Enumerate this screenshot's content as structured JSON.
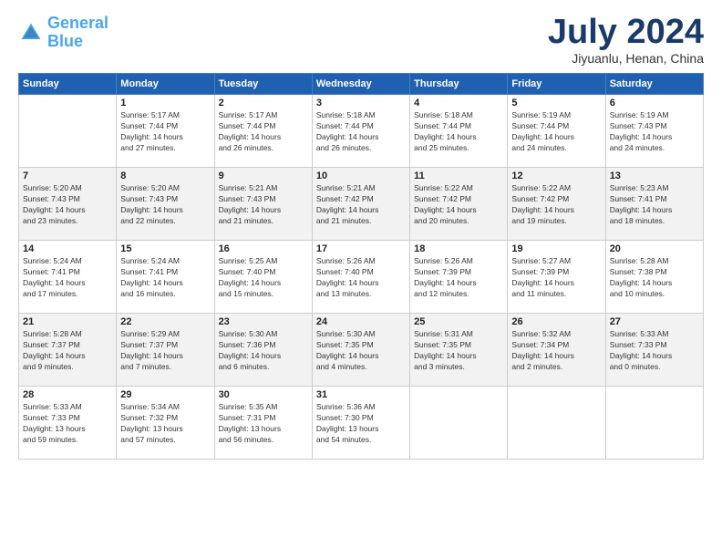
{
  "logo": {
    "line1": "General",
    "line2": "Blue"
  },
  "title": "July 2024",
  "subtitle": "Jiyuanlu, Henan, China",
  "days_of_week": [
    "Sunday",
    "Monday",
    "Tuesday",
    "Wednesday",
    "Thursday",
    "Friday",
    "Saturday"
  ],
  "weeks": [
    [
      {
        "day": "",
        "text": ""
      },
      {
        "day": "1",
        "text": "Sunrise: 5:17 AM\nSunset: 7:44 PM\nDaylight: 14 hours\nand 27 minutes."
      },
      {
        "day": "2",
        "text": "Sunrise: 5:17 AM\nSunset: 7:44 PM\nDaylight: 14 hours\nand 26 minutes."
      },
      {
        "day": "3",
        "text": "Sunrise: 5:18 AM\nSunset: 7:44 PM\nDaylight: 14 hours\nand 26 minutes."
      },
      {
        "day": "4",
        "text": "Sunrise: 5:18 AM\nSunset: 7:44 PM\nDaylight: 14 hours\nand 25 minutes."
      },
      {
        "day": "5",
        "text": "Sunrise: 5:19 AM\nSunset: 7:44 PM\nDaylight: 14 hours\nand 24 minutes."
      },
      {
        "day": "6",
        "text": "Sunrise: 5:19 AM\nSunset: 7:43 PM\nDaylight: 14 hours\nand 24 minutes."
      }
    ],
    [
      {
        "day": "7",
        "text": "Sunrise: 5:20 AM\nSunset: 7:43 PM\nDaylight: 14 hours\nand 23 minutes."
      },
      {
        "day": "8",
        "text": "Sunrise: 5:20 AM\nSunset: 7:43 PM\nDaylight: 14 hours\nand 22 minutes."
      },
      {
        "day": "9",
        "text": "Sunrise: 5:21 AM\nSunset: 7:43 PM\nDaylight: 14 hours\nand 21 minutes."
      },
      {
        "day": "10",
        "text": "Sunrise: 5:21 AM\nSunset: 7:42 PM\nDaylight: 14 hours\nand 21 minutes."
      },
      {
        "day": "11",
        "text": "Sunrise: 5:22 AM\nSunset: 7:42 PM\nDaylight: 14 hours\nand 20 minutes."
      },
      {
        "day": "12",
        "text": "Sunrise: 5:22 AM\nSunset: 7:42 PM\nDaylight: 14 hours\nand 19 minutes."
      },
      {
        "day": "13",
        "text": "Sunrise: 5:23 AM\nSunset: 7:41 PM\nDaylight: 14 hours\nand 18 minutes."
      }
    ],
    [
      {
        "day": "14",
        "text": "Sunrise: 5:24 AM\nSunset: 7:41 PM\nDaylight: 14 hours\nand 17 minutes."
      },
      {
        "day": "15",
        "text": "Sunrise: 5:24 AM\nSunset: 7:41 PM\nDaylight: 14 hours\nand 16 minutes."
      },
      {
        "day": "16",
        "text": "Sunrise: 5:25 AM\nSunset: 7:40 PM\nDaylight: 14 hours\nand 15 minutes."
      },
      {
        "day": "17",
        "text": "Sunrise: 5:26 AM\nSunset: 7:40 PM\nDaylight: 14 hours\nand 13 minutes."
      },
      {
        "day": "18",
        "text": "Sunrise: 5:26 AM\nSunset: 7:39 PM\nDaylight: 14 hours\nand 12 minutes."
      },
      {
        "day": "19",
        "text": "Sunrise: 5:27 AM\nSunset: 7:39 PM\nDaylight: 14 hours\nand 11 minutes."
      },
      {
        "day": "20",
        "text": "Sunrise: 5:28 AM\nSunset: 7:38 PM\nDaylight: 14 hours\nand 10 minutes."
      }
    ],
    [
      {
        "day": "21",
        "text": "Sunrise: 5:28 AM\nSunset: 7:37 PM\nDaylight: 14 hours\nand 9 minutes."
      },
      {
        "day": "22",
        "text": "Sunrise: 5:29 AM\nSunset: 7:37 PM\nDaylight: 14 hours\nand 7 minutes."
      },
      {
        "day": "23",
        "text": "Sunrise: 5:30 AM\nSunset: 7:36 PM\nDaylight: 14 hours\nand 6 minutes."
      },
      {
        "day": "24",
        "text": "Sunrise: 5:30 AM\nSunset: 7:35 PM\nDaylight: 14 hours\nand 4 minutes."
      },
      {
        "day": "25",
        "text": "Sunrise: 5:31 AM\nSunset: 7:35 PM\nDaylight: 14 hours\nand 3 minutes."
      },
      {
        "day": "26",
        "text": "Sunrise: 5:32 AM\nSunset: 7:34 PM\nDaylight: 14 hours\nand 2 minutes."
      },
      {
        "day": "27",
        "text": "Sunrise: 5:33 AM\nSunset: 7:33 PM\nDaylight: 14 hours\nand 0 minutes."
      }
    ],
    [
      {
        "day": "28",
        "text": "Sunrise: 5:33 AM\nSunset: 7:33 PM\nDaylight: 13 hours\nand 59 minutes."
      },
      {
        "day": "29",
        "text": "Sunrise: 5:34 AM\nSunset: 7:32 PM\nDaylight: 13 hours\nand 57 minutes."
      },
      {
        "day": "30",
        "text": "Sunrise: 5:35 AM\nSunset: 7:31 PM\nDaylight: 13 hours\nand 56 minutes."
      },
      {
        "day": "31",
        "text": "Sunrise: 5:36 AM\nSunset: 7:30 PM\nDaylight: 13 hours\nand 54 minutes."
      },
      {
        "day": "",
        "text": ""
      },
      {
        "day": "",
        "text": ""
      },
      {
        "day": "",
        "text": ""
      }
    ]
  ]
}
